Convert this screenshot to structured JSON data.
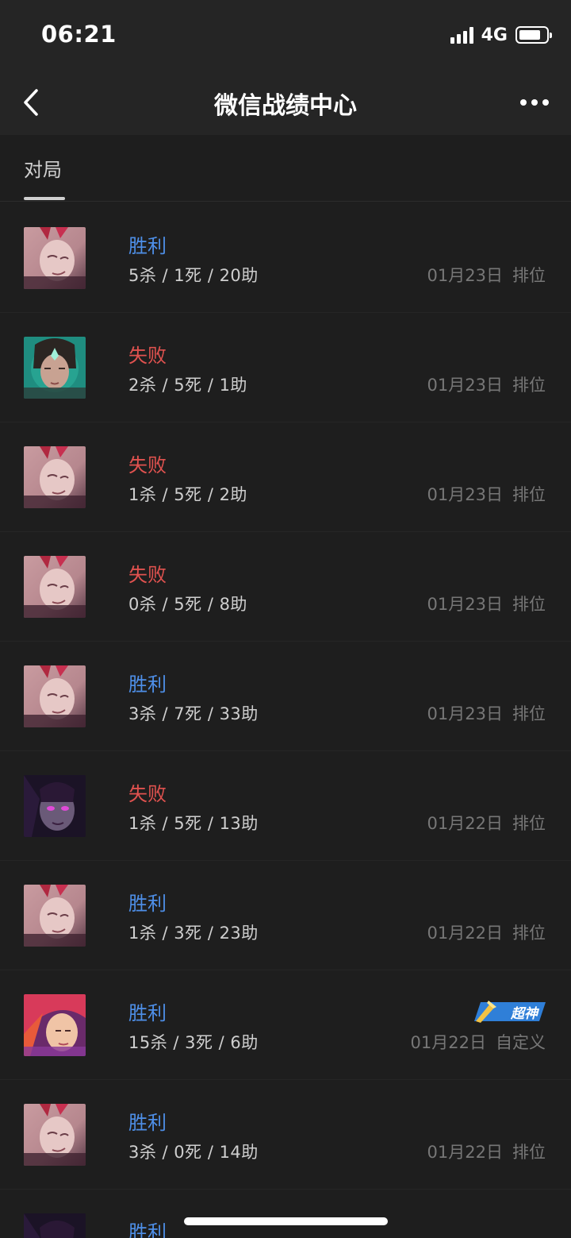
{
  "status": {
    "time": "06:21",
    "network": "4G"
  },
  "nav": {
    "title": "微信战绩中心"
  },
  "tabs": [
    {
      "label": "对局"
    }
  ],
  "matches": [
    {
      "hero": "hero-pale",
      "result": "胜利",
      "outcome": "win",
      "kda": "5杀 / 1死 / 20助",
      "date": "01月23日",
      "mode": "排位"
    },
    {
      "hero": "hero-green",
      "result": "失败",
      "outcome": "loss",
      "kda": "2杀 / 5死 / 1助",
      "date": "01月23日",
      "mode": "排位"
    },
    {
      "hero": "hero-pale",
      "result": "失败",
      "outcome": "loss",
      "kda": "1杀 / 5死 / 2助",
      "date": "01月23日",
      "mode": "排位"
    },
    {
      "hero": "hero-pale",
      "result": "失败",
      "outcome": "loss",
      "kda": "0杀 / 5死 / 8助",
      "date": "01月23日",
      "mode": "排位"
    },
    {
      "hero": "hero-pale",
      "result": "胜利",
      "outcome": "win",
      "kda": "3杀 / 7死 / 33助",
      "date": "01月23日",
      "mode": "排位"
    },
    {
      "hero": "hero-purple",
      "result": "失败",
      "outcome": "loss",
      "kda": "1杀 / 5死 / 13助",
      "date": "01月22日",
      "mode": "排位"
    },
    {
      "hero": "hero-pale",
      "result": "胜利",
      "outcome": "win",
      "kda": "1杀 / 3死 / 23助",
      "date": "01月22日",
      "mode": "排位"
    },
    {
      "hero": "hero-pink",
      "result": "胜利",
      "outcome": "win",
      "kda": "15杀 / 3死 / 6助",
      "date": "01月22日",
      "mode": "自定义",
      "badge": "超神"
    },
    {
      "hero": "hero-pale",
      "result": "胜利",
      "outcome": "win",
      "kda": "3杀 / 0死 / 14助",
      "date": "01月22日",
      "mode": "排位"
    },
    {
      "hero": "hero-purple",
      "result": "胜利",
      "outcome": "win",
      "kda": "",
      "date": "",
      "mode": ""
    }
  ],
  "colors": {
    "win": "#4e8fe8",
    "loss": "#e0524f",
    "background": "#1e1e1e",
    "bar": "#252525"
  }
}
